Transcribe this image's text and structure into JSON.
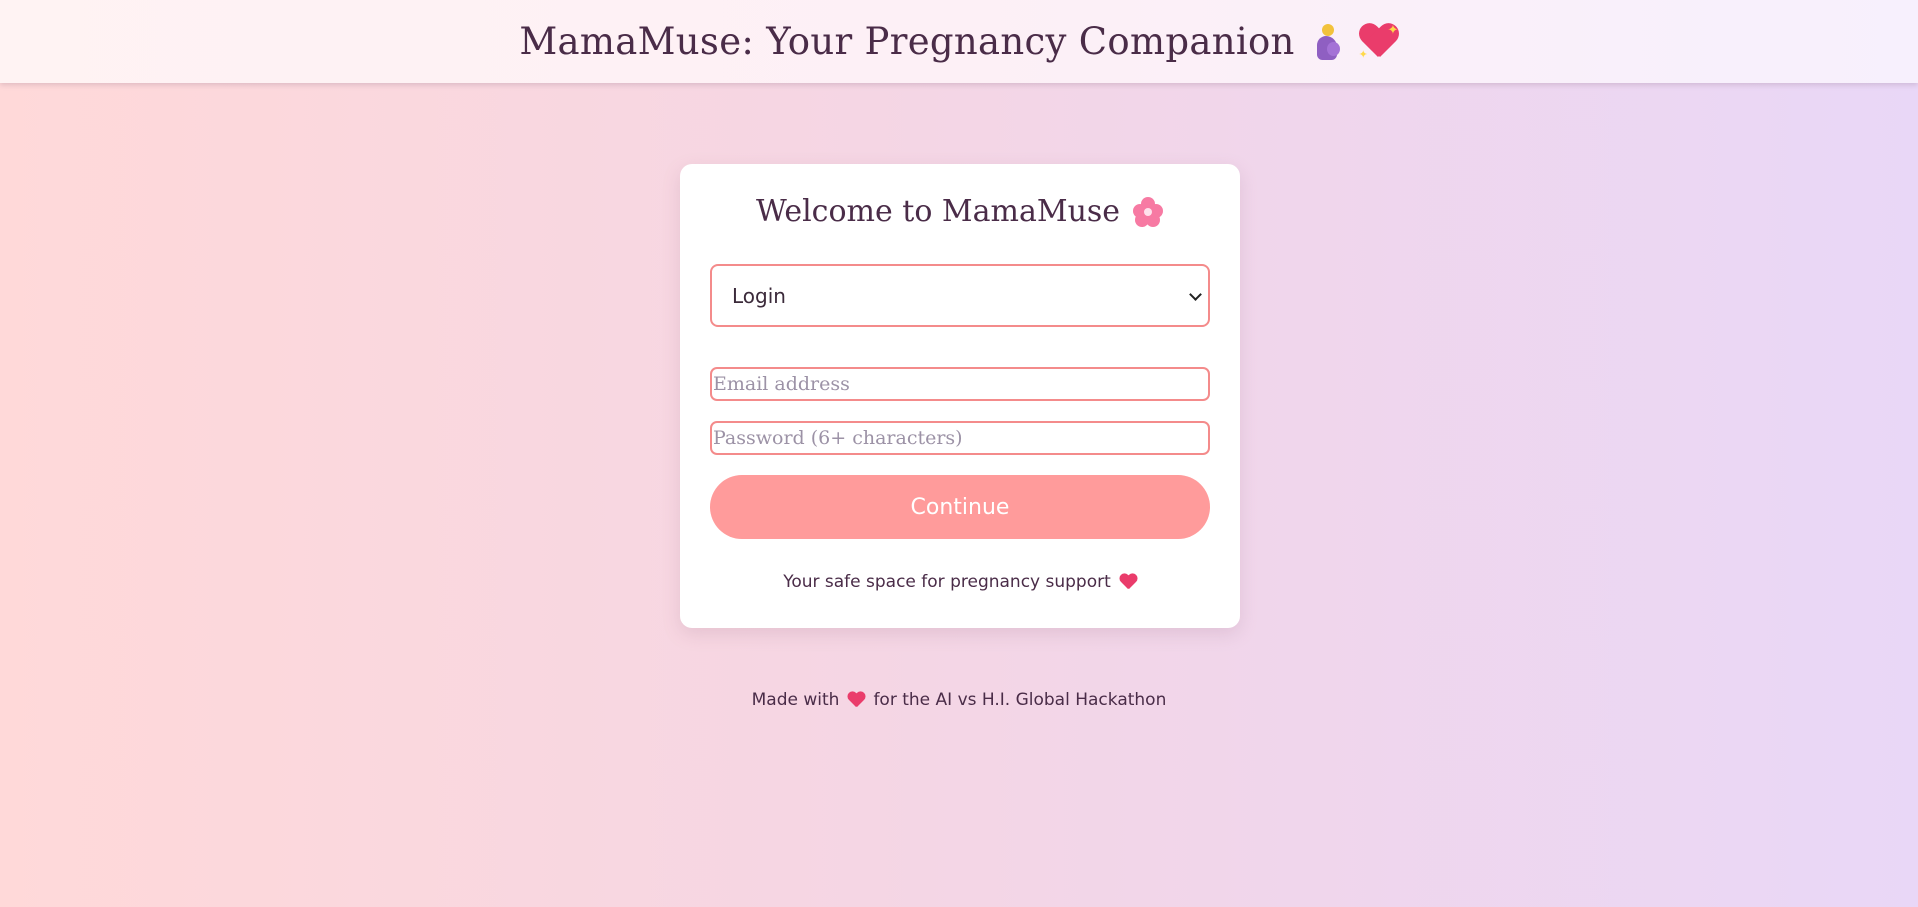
{
  "header": {
    "title": "MamaMuse: Your Pregnancy Companion",
    "icons": [
      "pregnant-woman-icon",
      "sparkling-heart-icon"
    ]
  },
  "card": {
    "welcome": "Welcome to MamaMuse",
    "welcome_icon": "cherry-blossom-icon",
    "mode_select": {
      "selected": "Login"
    },
    "email": {
      "value": "",
      "placeholder": "Email address"
    },
    "password": {
      "value": "",
      "placeholder": "Password (6+ characters)"
    },
    "continue_label": "Continue",
    "tagline": "Your safe space for pregnancy support",
    "tagline_icon": "two-hearts-icon"
  },
  "footer": {
    "prefix": "Made with",
    "suffix": "for the AI vs H.I. Global Hackathon",
    "icon": "heart-icon"
  },
  "colors": {
    "accent": "#ff9b9b",
    "border": "#f48b8b",
    "text": "#4a2c48"
  }
}
